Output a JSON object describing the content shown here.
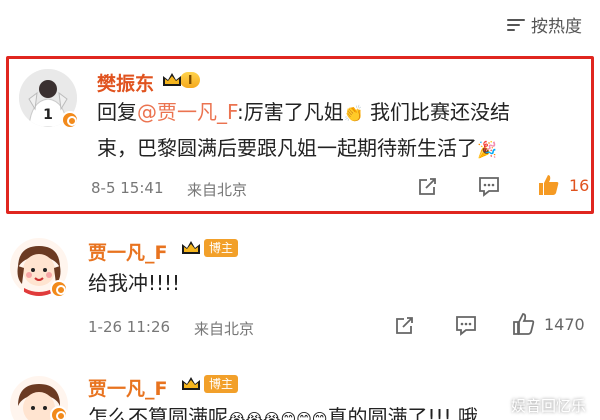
{
  "sort": {
    "label": "按热度"
  },
  "comments": [
    {
      "name": "樊振东",
      "level": "I",
      "content_prefix": "回复",
      "mention": "@贾一凡_F",
      "content_main": ":厉害了凡姐",
      "content_rest": " 我们比赛还没结",
      "content_line2": "束，巴黎圆满后要跟凡姐一起期待新生活了",
      "time": "8-5 15:41",
      "location": "来自北京",
      "likes": "16"
    },
    {
      "name": "贾一凡_F",
      "badge": "博主",
      "content": "给我冲!!!!",
      "time": "1-26 11:26",
      "location": "来自北京",
      "likes": "1470"
    },
    {
      "name": "贾一凡_F",
      "badge": "博主",
      "content_a": "怎么不算圆满呢",
      "content_b": "真的圆满了!!! 哦"
    }
  ],
  "watermark": {
    "text": "娱音回忆乐"
  },
  "colors": {
    "accent": "#e0261f",
    "mention": "#eb7350",
    "name_orange": "#e8731f",
    "host_badge": "#f2a02a"
  }
}
